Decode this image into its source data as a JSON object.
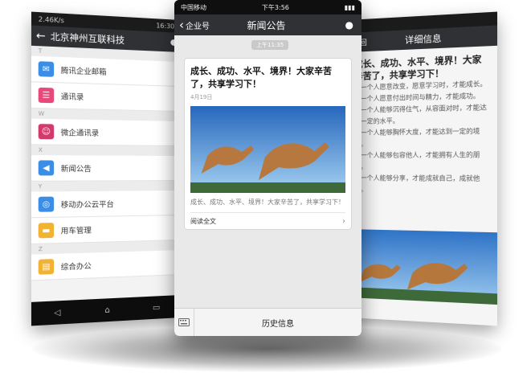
{
  "left_phone": {
    "status": {
      "carrier": "2.46K/s",
      "time": "16:30"
    },
    "header": {
      "title": "北京神州互联科技"
    },
    "sections": [
      {
        "letter": "T",
        "items": [
          {
            "label": "腾讯企业邮箱",
            "icon": "mail-icon",
            "color": "#3a8ee6"
          },
          {
            "label": "通讯录",
            "icon": "contacts-icon",
            "color": "#e8487a"
          }
        ]
      },
      {
        "letter": "W",
        "items": [
          {
            "label": "微企通讯录",
            "icon": "people-icon",
            "color": "#d23a6c"
          }
        ]
      },
      {
        "letter": "X",
        "items": [
          {
            "label": "新闻公告",
            "icon": "megaphone-icon",
            "color": "#3a8ee6"
          }
        ]
      },
      {
        "letter": "Y",
        "items": [
          {
            "label": "移动办公云平台",
            "icon": "globe-icon",
            "color": "#3a8ee6"
          },
          {
            "label": "用车管理",
            "icon": "car-icon",
            "color": "#f2b233"
          }
        ]
      },
      {
        "letter": "Z",
        "items": [
          {
            "label": "综合办公",
            "icon": "chart-icon",
            "color": "#f2b233"
          }
        ]
      }
    ]
  },
  "center_phone": {
    "status": {
      "carrier": "中国移动",
      "time": "下午3:56"
    },
    "header": {
      "back_label": "企业号",
      "title": "新闻公告"
    },
    "message": {
      "time_chip": "上午11:35",
      "title": "成长、成功、水平、境界！大家辛苦了，共享学习下！",
      "date": "4月19日",
      "summary": "成长、成功、水平、境界！大家辛苦了，共享学习下！",
      "read_more": "阅读全文"
    },
    "bottom": {
      "history_label": "历史信息"
    }
  },
  "right_phone": {
    "header": {
      "back_label": "返回",
      "title": "详细信息"
    },
    "article": {
      "title": "成长、成功、水平、境界！大家辛苦了，共享学习下！",
      "paragraphs": [
        "当一个人愿意改变，愿意学习时，才能成长。",
        "当一个人愿意付出时间与精力，才能成功。",
        "当一个人能够沉得住气，从容面对时，才能达到一定的水平。",
        "当一个人能够胸怀大度，才能达到一定的境界。",
        "当一个人能够包容他人，才能拥有人生的朋友。",
        "当一个人能够分享，才能成就自己，成就他人。"
      ]
    }
  }
}
